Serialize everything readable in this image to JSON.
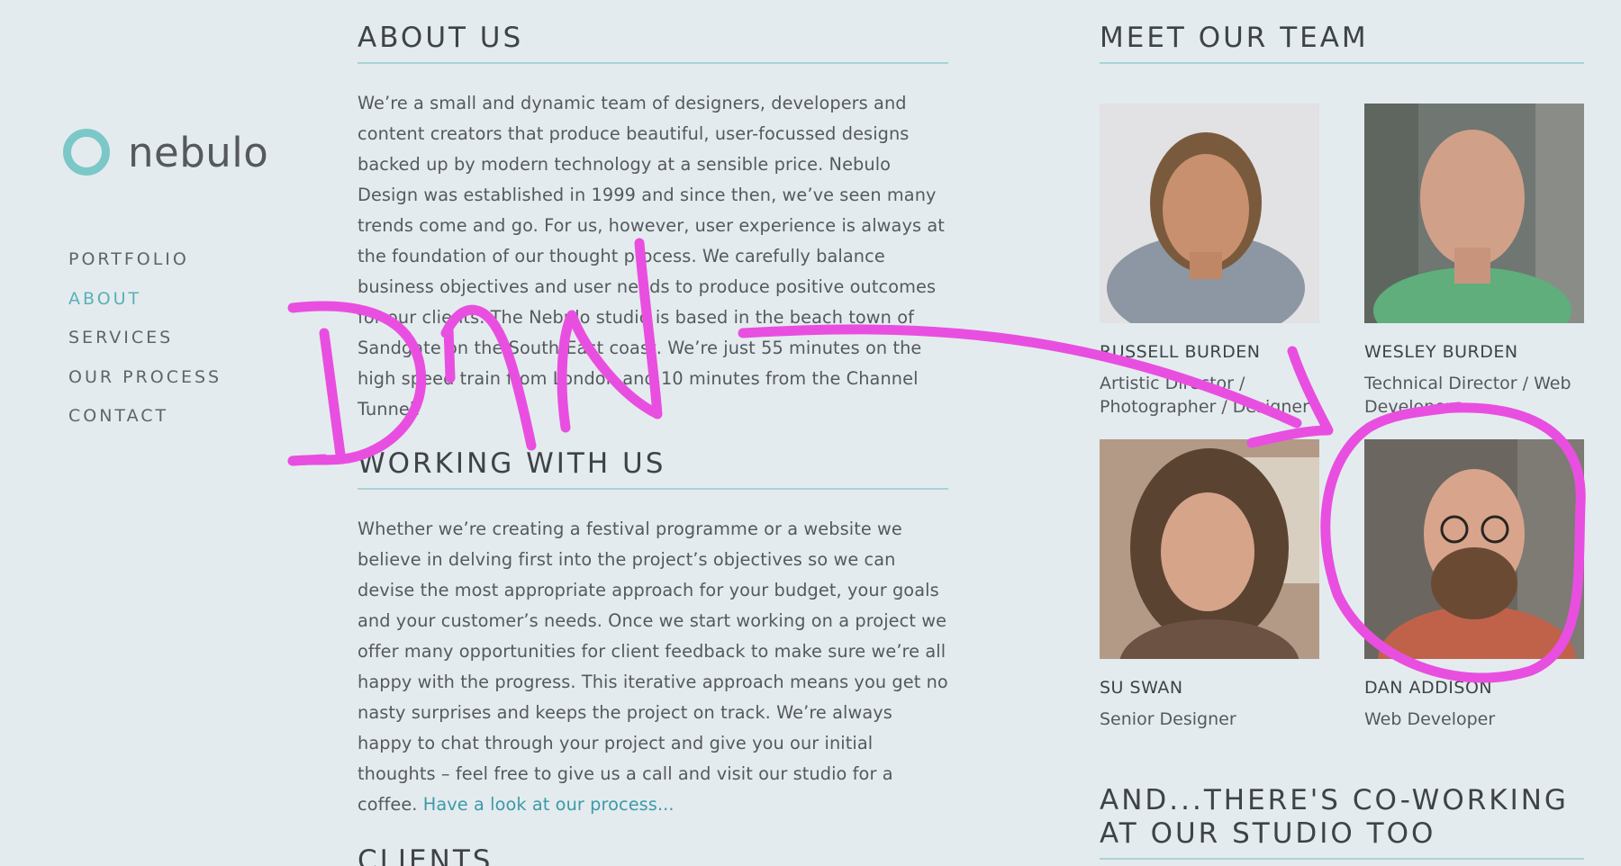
{
  "brand": {
    "name": "nebulo"
  },
  "nav": {
    "items": [
      {
        "label": "PORTFOLIO",
        "active": false
      },
      {
        "label": "ABOUT",
        "active": true
      },
      {
        "label": "SERVICES",
        "active": false
      },
      {
        "label": "OUR PROCESS",
        "active": false
      },
      {
        "label": "CONTACT",
        "active": false
      }
    ]
  },
  "about": {
    "title": "ABOUT US",
    "body": "We’re a small and dynamic team of designers, developers and content creators that produce beautiful, user-focussed designs backed up by modern technology at a sensible price. Nebulo Design was established in 1999 and since then, we’ve seen many trends come and go. For us, however, user experience is always at the foundation of our thought process. We carefully balance business objectives and user needs to produce positive outcomes for our clients. The Nebulo studio is based in the beach town of Sandgate on the South-East coast. We’re just 55 minutes on the high speed train from London and 10 minutes from the Channel Tunnel."
  },
  "working": {
    "title": "WORKING WITH US",
    "body": "Whether we’re creating a festival programme or a website we believe in delving first into the project’s objectives so we can devise the most appropriate approach for your budget, your goals and your customer’s needs. Once we start working on a project we offer many opportunities for client feedback to make sure we’re all happy with the progress. This iterative approach means you get no nasty surprises and keeps the project on track. We’re always happy to chat through your project and give you our initial thoughts – feel free to give us a call and visit our studio for a coffee.",
    "link": "Have a look at our process..."
  },
  "clients": {
    "title": "CLIENTS"
  },
  "team": {
    "title": "MEET OUR TEAM",
    "members": [
      {
        "name": "RUSSELL BURDEN",
        "role": "Artistic Director / Photographer / Designer"
      },
      {
        "name": "WESLEY BURDEN",
        "role": "Technical Director / Web Developer"
      },
      {
        "name": "SU SWAN",
        "role": "Senior Designer"
      },
      {
        "name": "DAN ADDISON",
        "role": "Web Developer"
      }
    ]
  },
  "coworking": {
    "title": "AND...THERE'S CO-WORKING AT OUR STUDIO TOO"
  },
  "annotation": {
    "text": "DAN",
    "color": "#e84fe0"
  },
  "colors": {
    "accent": "#5ab0b8",
    "background": "#e4ebee",
    "rule": "#a9d3d5"
  }
}
